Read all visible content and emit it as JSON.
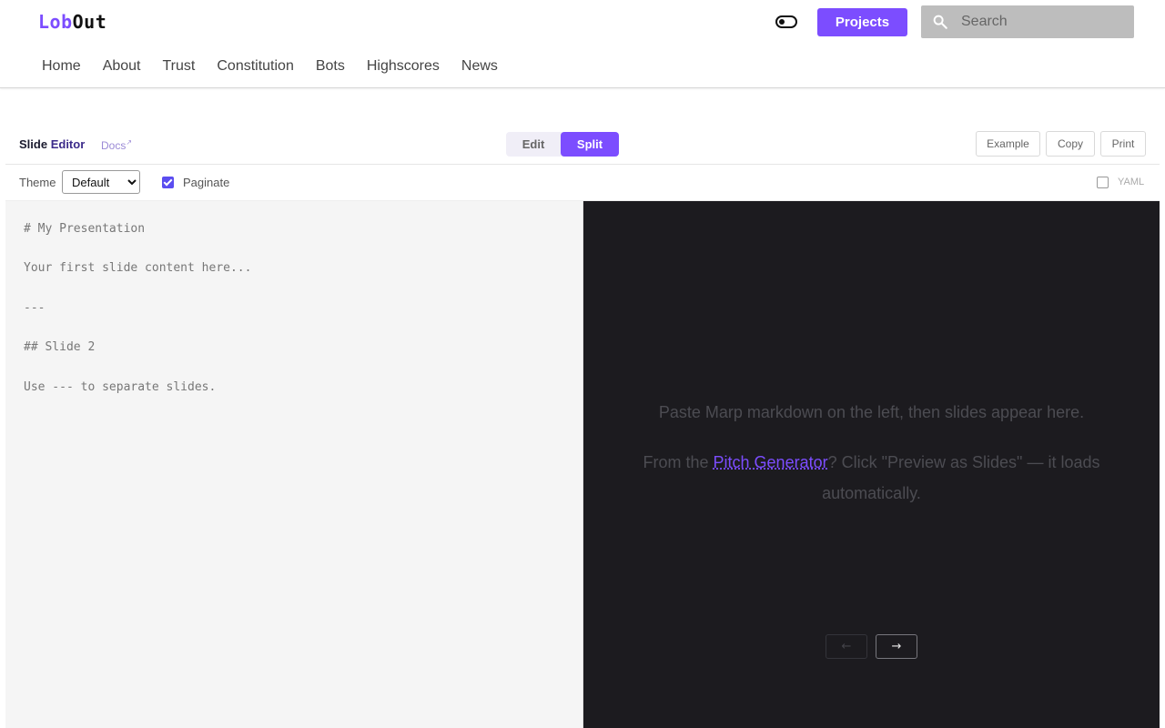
{
  "header": {
    "logo_part1": "Lob",
    "logo_part2": "Out",
    "projects_label": "Projects",
    "search_placeholder": "Search",
    "nav": [
      "Home",
      "About",
      "Trust",
      "Constitution",
      "Bots",
      "Highscores",
      "News"
    ]
  },
  "editor": {
    "title_part1": "Slide",
    "title_part2": "Editor",
    "docs_label": "Docs",
    "docs_icon": "external-link-icon",
    "modes": [
      "Edit",
      "Split"
    ],
    "active_mode": "Split",
    "actions": [
      "Example",
      "Copy",
      "Print"
    ],
    "theme_label": "Theme",
    "theme_value": "Default",
    "paginate_label": "Paginate",
    "paginate_checked": true,
    "yaml_label": "YAML",
    "yaml_checked": false,
    "markdown": "# My Presentation\n\nYour first slide content here...\n\n---\n\n## Slide 2\n\nUse --- to separate slides."
  },
  "preview": {
    "message1": "Paste Marp markdown on the left, then slides appear here.",
    "message2_before": "From the ",
    "message2_link": "Pitch Generator",
    "message2_after": "? Click \"Preview as Slides\" — it loads automatically.",
    "prev_label": "←",
    "next_label": "→"
  },
  "colors": {
    "accent": "#7c4dff",
    "preview_bg": "#1c1b1f",
    "editor_bg": "#f5f5f5"
  }
}
